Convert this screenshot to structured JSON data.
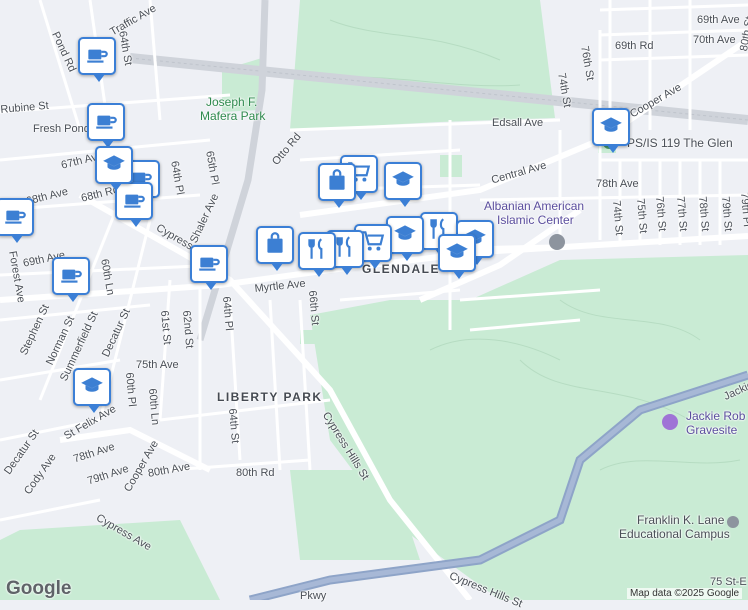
{
  "map": {
    "area_labels": [
      "GLENDALE",
      "LIBERTY PARK"
    ],
    "park_labels": [
      "Joseph F.",
      "Mafera Park"
    ],
    "poi_labels": [
      "Albanian American",
      "Islamic Center",
      "Jackie Rob",
      "Gravesite"
    ],
    "school_labels": [
      "PS/IS 119 The Glen",
      "Franklin K. Lane",
      "Educational Campus"
    ],
    "street_labels": [
      "Pond Rd",
      "Traffic Ave",
      "64th St",
      "69th Ave",
      "69th Rd",
      "70th Ave",
      "80th St",
      "Otto Rd",
      "Edsall Ave",
      "Central Ave",
      "Cooper Ave",
      "76th St",
      "74th St",
      "Fresh Pond",
      "67th Ave",
      "68th Ave",
      "68th Rd",
      "64th Pl",
      "65th Pl",
      "Shaler Ave",
      "Cypress Ave",
      "69th Ave",
      "60th Ln",
      "Forest Ave",
      "Stephen St",
      "Norman St",
      "Summerfield St",
      "Decatur St",
      "61st St",
      "62nd St",
      "64th Pl",
      "Myrtle Ave",
      "66th St",
      "78th Ave",
      "75th St",
      "76th St",
      "77th St",
      "78th St",
      "79th St",
      "79th Pl",
      "74th St",
      "75th Ave",
      "60th Pl",
      "60th Ln",
      "64th St",
      "Cypress Hills St",
      "St Felix Ave",
      "78th Ave",
      "79th Ave",
      "80th Ave",
      "Cooper Ave",
      "80th Rd",
      "Decatur St",
      "Cody Ave",
      "Cypress Ave",
      "Jackie",
      "Cypress Hills St",
      "75 St-E",
      "Rubine St",
      "Pkwy"
    ],
    "marker_icons": [
      "coffee-icon",
      "coffee-icon",
      "coffee-icon",
      "coffee-icon",
      "coffee-icon",
      "coffee-icon",
      "coffee-icon",
      "school-icon",
      "school-icon",
      "school-icon",
      "school-icon",
      "school-icon",
      "shopping-bag-icon",
      "shopping-bag-icon",
      "shopping-cart-icon",
      "shopping-cart-icon",
      "restaurant-icon",
      "restaurant-icon",
      "restaurant-icon"
    ],
    "brand": "Google",
    "copyright": "Map data ©2025 Google"
  }
}
